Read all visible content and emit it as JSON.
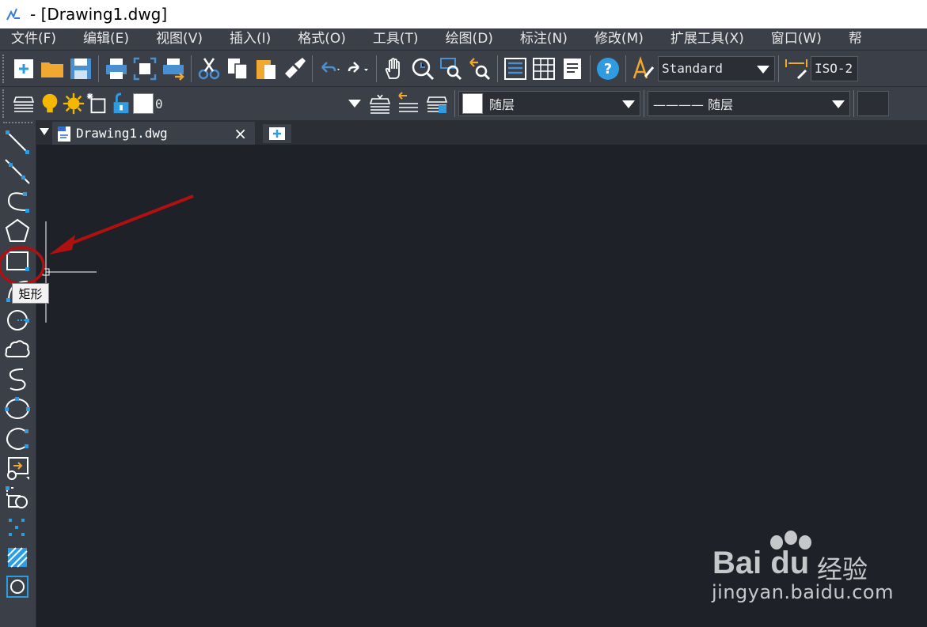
{
  "window": {
    "title": " - [Drawing1.dwg]"
  },
  "menu": [
    "文件(F)",
    "编辑(E)",
    "视图(V)",
    "插入(I)",
    "格式(O)",
    "工具(T)",
    "绘图(D)",
    "标注(N)",
    "修改(M)",
    "扩展工具(X)",
    "窗口(W)",
    "帮"
  ],
  "toolbar1": {
    "text_style": "Standard",
    "dim_style": "ISO-2"
  },
  "toolbar2": {
    "layer_name": "0",
    "color": "随层",
    "linetype": "———— 随层"
  },
  "tabs": {
    "document": "Drawing1.dwg",
    "close_symbol": "×"
  },
  "tooltip": {
    "text": "矩形"
  },
  "watermark": {
    "brand": "Bai du",
    "cn": "经验",
    "url": "jingyan.baidu.com"
  },
  "colors": {
    "background": "#1e2128",
    "toolbar": "#3b3f48",
    "accent": "#2f9be0",
    "annotation": "#b01010"
  },
  "left_tools": [
    "line-icon",
    "construction-line-icon",
    "polyline-icon",
    "polygon-icon",
    "rectangle-icon",
    "arc-icon",
    "circle-icon",
    "revision-cloud-icon",
    "spline-icon",
    "ellipse-icon",
    "ellipse-arc-icon",
    "insert-block-icon",
    "create-block-icon",
    "point-icon",
    "hatch-icon",
    "region-icon"
  ]
}
